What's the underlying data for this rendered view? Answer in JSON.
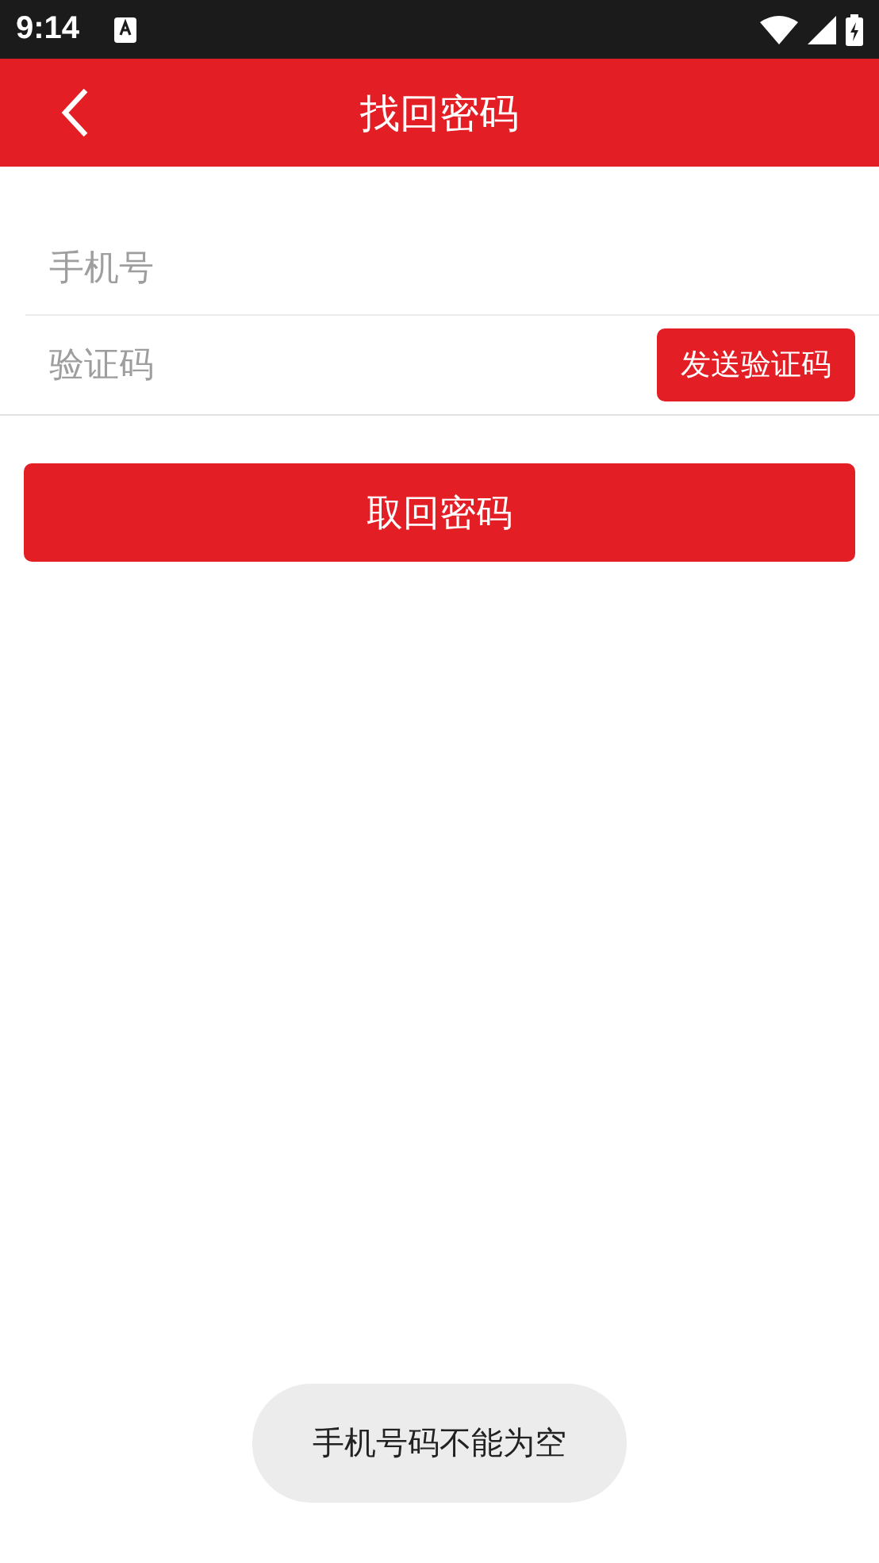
{
  "status_bar": {
    "time": "9:14"
  },
  "header": {
    "title": "找回密码"
  },
  "form": {
    "phone": {
      "placeholder": "手机号"
    },
    "code": {
      "placeholder": "验证码"
    },
    "send_code_button": "发送验证码"
  },
  "submit_button": "取回密码",
  "toast": "手机号码不能为空"
}
